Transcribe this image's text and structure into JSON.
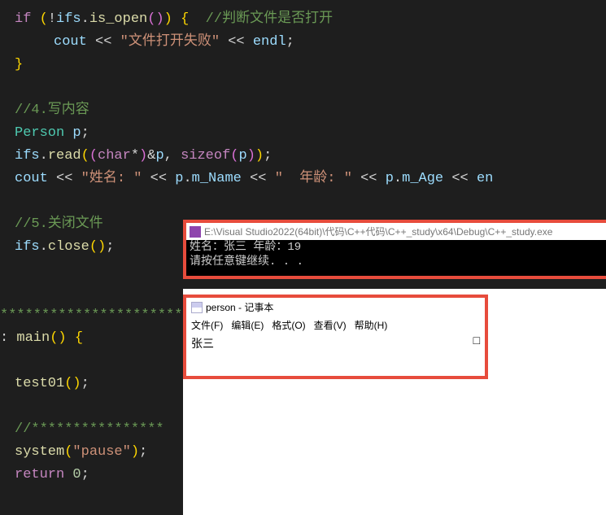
{
  "code": {
    "l1_if": "if",
    "l1_neg": "!",
    "l1_ifs": "ifs",
    "l1_dot": ".",
    "l1_isopen": "is_open",
    "l1_cmt": "//判断文件是否打开",
    "l2_cout": "cout",
    "l2_lshift1": "<<",
    "l2_str": "\"文件打开失败\"",
    "l2_lshift2": "<<",
    "l2_endl": "endl",
    "l3_close": "}",
    "l5_cmt": "//4.写内容",
    "l6_type": "Person",
    "l6_var": "p",
    "l7_ifs": "ifs",
    "l7_read": "read",
    "l7_char": "char",
    "l7_amp": "&",
    "l7_p": "p",
    "l7_sizeof": "sizeof",
    "l7_p2": "p",
    "l8_cout": "cout",
    "l8_str1": "\"姓名: \"",
    "l8_name": "m_Name",
    "l8_str2": "\"  年龄: \"",
    "l8_age": "m_Age",
    "l8_en": "en",
    "l10_cmt": "//5.关闭文件",
    "l11_ifs": "ifs",
    "l11_close": "close",
    "stars1": "******************************",
    "main_kw": "main",
    "test": "test01",
    "stars2": "//****************",
    "system": "system",
    "pause": "\"pause\"",
    "return_kw": "return",
    "return_val": "0"
  },
  "console": {
    "path": "E:\\Visual Studio2022(64bit)\\代码\\C++代码\\C++_study\\x64\\Debug\\C++_study.exe",
    "line1": "姓名：张三   年龄：19",
    "line2": "请按任意键继续. . ."
  },
  "notepad": {
    "title": "person - 记事本",
    "menu": {
      "file": "文件(F)",
      "edit": "编辑(E)",
      "format": "格式(O)",
      "view": "查看(V)",
      "help": "帮助(H)"
    },
    "content": "张三",
    "box": "□"
  }
}
